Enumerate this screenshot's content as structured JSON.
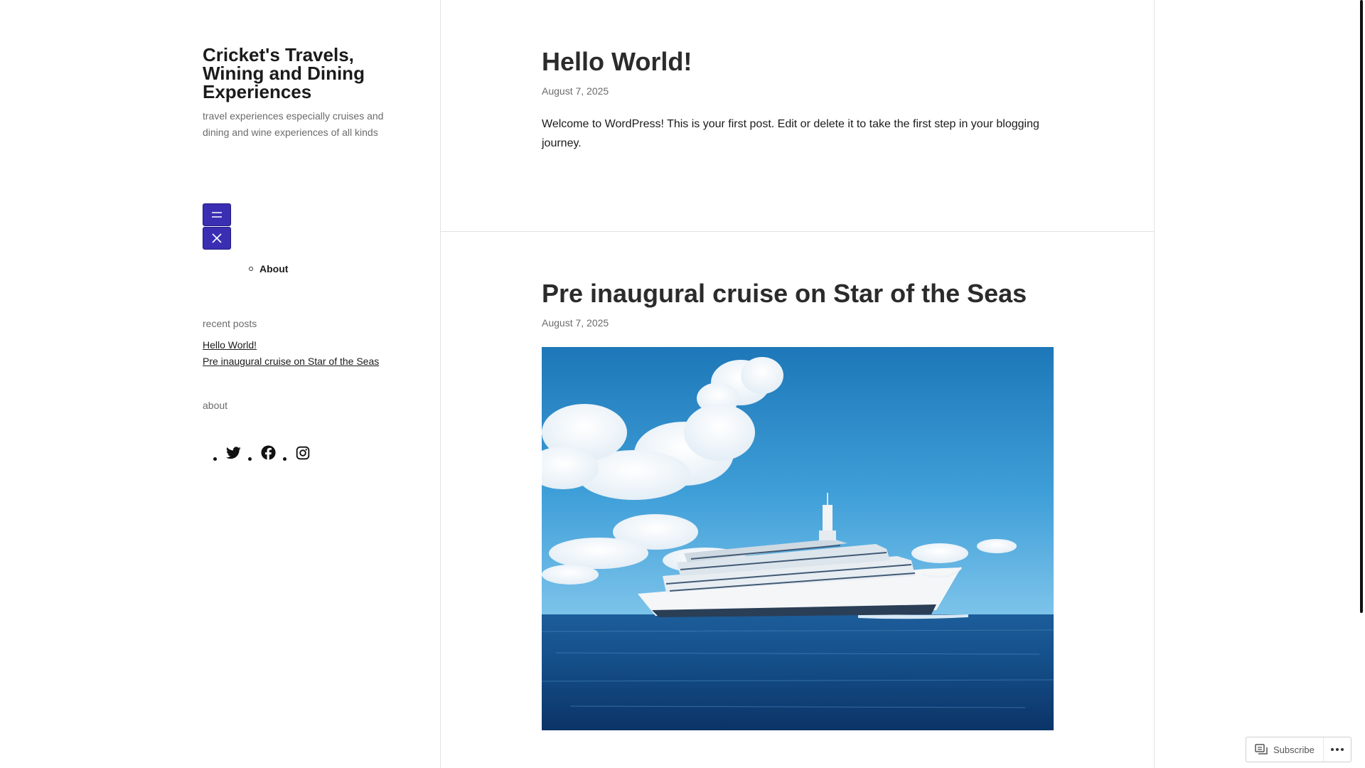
{
  "site": {
    "title": "Cricket's Travels, Wining and Dining Experiences",
    "tagline": "travel experiences especially cruises and dining and wine experiences of all kinds"
  },
  "nav": {
    "open_icon": "menu-icon",
    "close_icon": "close-icon",
    "items": [
      {
        "label": "About"
      }
    ]
  },
  "widgets": {
    "recent_posts_title": "recent posts",
    "recent_posts": [
      {
        "label": "Hello World!"
      },
      {
        "label": "Pre inaugural cruise on Star of the Seas"
      }
    ],
    "about_title": "about",
    "social_icons": [
      "twitter-icon",
      "facebook-icon",
      "instagram-icon"
    ]
  },
  "posts": [
    {
      "title": "Hello World!",
      "date": "August 7, 2025",
      "body": "Welcome to WordPress! This is your first post. Edit or delete it to take the first step in your blogging journey."
    },
    {
      "title": "Pre inaugural cruise on Star of the Seas",
      "date": "August 7, 2025",
      "image": "cruise-ship-at-sea-photo"
    }
  ],
  "subscribe": {
    "label": "Subscribe",
    "more_icon": "ellipsis-icon"
  },
  "colors": {
    "menu_button": "#3a2fb3",
    "text": "#1b1b1b",
    "muted": "#6b6b6b",
    "divider": "#e3e3e3"
  }
}
